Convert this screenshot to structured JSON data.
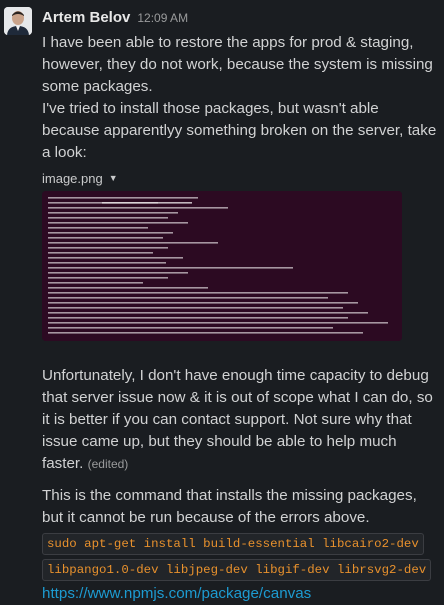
{
  "message": {
    "author": "Artem Belov",
    "time": "12:09 AM",
    "text_1": "I have been able to restore the apps for prod & staging, however, they do not work, because the system is missing some packages.",
    "text_2": "I've tried to install those packages, but wasn't able because apparentlyy something broken on the server, take a look:",
    "attachment": {
      "filename": "image.png",
      "caret_icon": "chevron-down-icon",
      "background": "#2c0a22"
    },
    "text_3": "Unfortunately, I don't have enough time capacity to debug that server issue now & it is out of scope what I can do, so it is better if you can contact support. Not sure why that issue came up, but they should be able to help much faster.",
    "edited_label": "(edited)",
    "text_4": "This is the command that installs the missing packages, but it cannot be run because of the errors above.",
    "code_1": "sudo apt-get install build-essential libcairo2-dev",
    "code_2": "libpango1.0-dev libjpeg-dev libgif-dev librsvg2-dev",
    "link": "https://www.npmjs.com/package/canvas"
  },
  "colors": {
    "background": "#1a1d21",
    "text": "#d1d2d3",
    "code": "#e8912d",
    "link": "#1d9bd1"
  }
}
